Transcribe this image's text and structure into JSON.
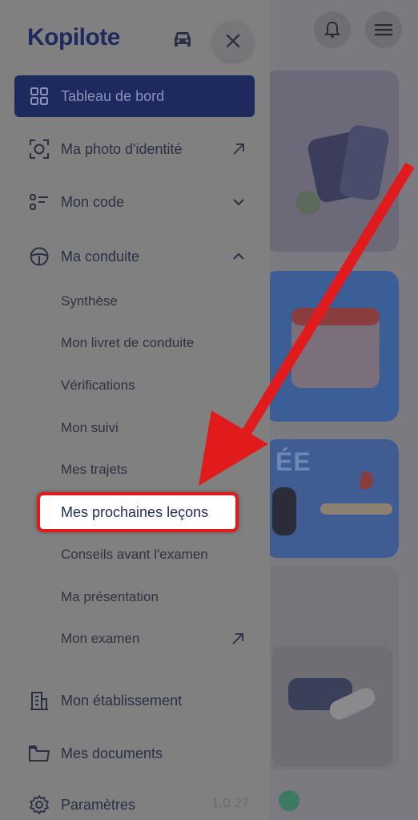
{
  "app": {
    "logo": "Kopilote",
    "version": "1.0.27"
  },
  "drawer": {
    "menu": [
      {
        "label": "Tableau de bord",
        "icon": "dashboard-icon",
        "active": true
      },
      {
        "label": "Ma photo d'identité",
        "icon": "camera-icon",
        "trail": "external-link-icon"
      },
      {
        "label": "Mon code",
        "icon": "list-icon",
        "trail": "chevron-down-icon"
      },
      {
        "label": "Ma conduite",
        "icon": "steering-wheel-icon",
        "trail": "chevron-up-icon"
      }
    ],
    "sub_items": [
      "Synthèse",
      "Mon livret de conduite",
      "Vérifications",
      "Mon suivi",
      "Mes trajets",
      "Mes prochaines leçons",
      "Conseils avant l'examen",
      "Ma présentation",
      "Mon examen"
    ],
    "bottom_menu": [
      {
        "label": "Mon établissement",
        "icon": "building-icon"
      },
      {
        "label": "Mes documents",
        "icon": "folder-icon"
      },
      {
        "label": "Paramètres",
        "icon": "gear-icon"
      }
    ]
  },
  "background": {
    "card3_title": "ÉE"
  },
  "annotation": {
    "highlight_color": "#e11b1b"
  }
}
